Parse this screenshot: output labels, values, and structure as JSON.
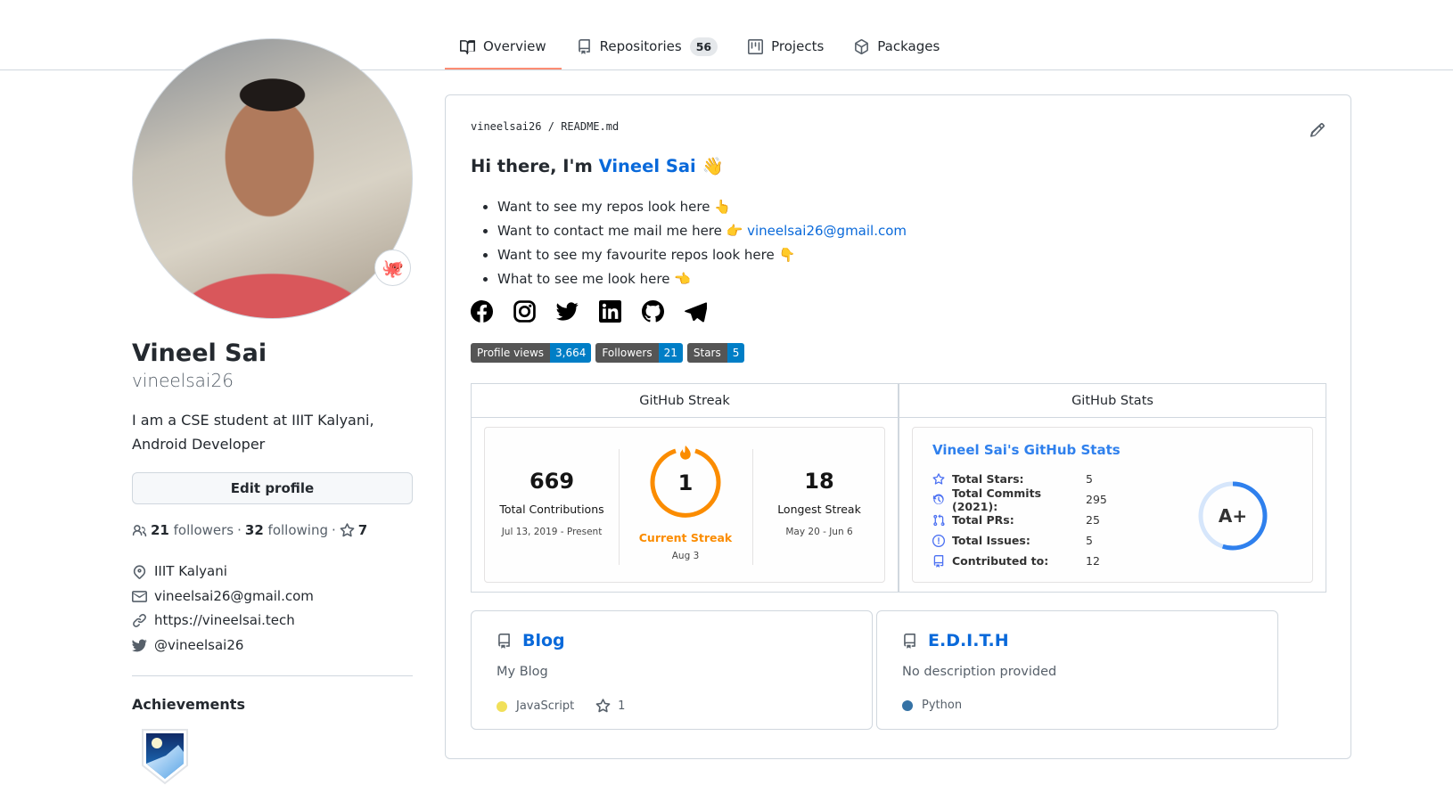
{
  "nav": {
    "tabs": [
      {
        "label": "Overview",
        "icon": "book-icon",
        "active": true
      },
      {
        "label": "Repositories",
        "icon": "repo-icon",
        "count": "56"
      },
      {
        "label": "Projects",
        "icon": "project-icon"
      },
      {
        "label": "Packages",
        "icon": "package-icon"
      }
    ]
  },
  "profile": {
    "name": "Vineel Sai",
    "login": "vineelsai26",
    "status_emoji": "🐙",
    "bio_line1": "I am a CSE student at IIIT Kalyani,",
    "bio_line2": "Android Developer",
    "edit_label": "Edit profile",
    "followers_count": "21",
    "followers_label": "followers",
    "following_count": "32",
    "following_label": "following",
    "stars_count": "7",
    "location": "IIIT Kalyani",
    "email": "vineelsai26@gmail.com",
    "website": "https://vineelsai.tech",
    "twitter": "@vineelsai26",
    "achievements_title": "Achievements",
    "achievement_badge": "arctic-code-vault-badge"
  },
  "readme": {
    "crumb_owner": "vineelsai26",
    "crumb_sep": "/",
    "crumb_file": "README.md",
    "greeting_prefix": "Hi there, I'm ",
    "greeting_name": "Vineel Sai",
    "greeting_emoji": "👋",
    "bullets": [
      {
        "text": "Want to see my repos look here ",
        "emoji": "👆"
      },
      {
        "text": "Want to contact me mail me here ",
        "emoji": "👉",
        "link": "vineelsai26@gmail.com"
      },
      {
        "text": "Want to see my favourite repos look here ",
        "emoji": "👇"
      },
      {
        "text": "What to see me look here ",
        "emoji": "👈"
      }
    ],
    "social_icons": [
      "facebook-icon",
      "instagram-icon",
      "twitter-icon",
      "linkedin-icon",
      "github-icon",
      "telegram-icon"
    ],
    "shields": [
      {
        "label": "Profile views",
        "value": "3,664"
      },
      {
        "label": "Followers",
        "value": "21"
      },
      {
        "label": "Stars",
        "value": "5"
      }
    ],
    "streak": {
      "header": "GitHub Streak",
      "total": "669",
      "total_label": "Total Contributions",
      "total_range": "Jul 13, 2019 - Present",
      "current": "1",
      "current_label": "Current Streak",
      "current_date": "Aug 3",
      "longest": "18",
      "longest_label": "Longest Streak",
      "longest_range": "May 20 - Jun 6",
      "accent": "#fb8c00"
    },
    "stats": {
      "header": "GitHub Stats",
      "title": "Vineel Sai's GitHub Stats",
      "rows": [
        {
          "icon": "star-icon",
          "label": "Total Stars:",
          "value": "5"
        },
        {
          "icon": "history-icon",
          "label": "Total Commits (2021):",
          "value": "295"
        },
        {
          "icon": "pull-request-icon",
          "label": "Total PRs:",
          "value": "25"
        },
        {
          "icon": "issue-icon",
          "label": "Total Issues:",
          "value": "5"
        },
        {
          "icon": "repo-icon",
          "label": "Contributed to:",
          "value": "12"
        }
      ],
      "rank": "A+",
      "rank_progress": 0.55,
      "accent": "#2f80ed"
    },
    "repos": [
      {
        "name": "Blog",
        "description": "My Blog",
        "language": "JavaScript",
        "language_color": "#f1e05a",
        "stars": "1"
      },
      {
        "name": "E.D.I.T.H",
        "description": "No description provided",
        "language": "Python",
        "language_color": "#3572A5"
      }
    ]
  }
}
